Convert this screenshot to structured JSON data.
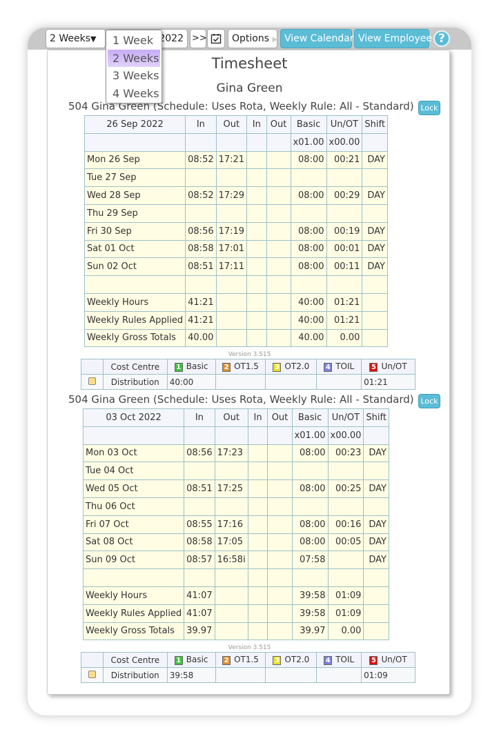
{
  "toolbar": {
    "period": "2 Weeks",
    "date_fragment": "2022",
    "next": ">>",
    "options": "Options",
    "view_calendar": "View Calendar",
    "view_employee": "View Employee",
    "help": "?"
  },
  "period_options": [
    "1 Week",
    "2 Weeks",
    "3 Weeks",
    "4 Weeks"
  ],
  "title": "Timesheet",
  "employee": "Gina Green",
  "columns": [
    "In",
    "Out",
    "In",
    "Out",
    "Basic",
    "Un/OT",
    "Shift"
  ],
  "rates": {
    "basic": "x01.00",
    "unot": "x00.00"
  },
  "lock_label": "Lock",
  "version": "Version 3.515",
  "colors": {
    "accent": "#5bbcd6",
    "row": "#fffde3",
    "b1": "#3cc43c",
    "b2": "#e0902a",
    "b3": "#e8e020",
    "b4": "#8080dd",
    "b5": "#dd1111"
  },
  "cost": {
    "headers": [
      "Cost Centre",
      "Basic",
      "OT1.5",
      "OT2.0",
      "TOIL",
      "Un/OT"
    ],
    "badges": [
      "1",
      "2",
      "3",
      "4",
      "5"
    ],
    "row_label": "Distribution"
  },
  "weeks": [
    {
      "header": "504 Gina Green (Schedule: Uses Rota, Weekly Rule: All - Standard)",
      "week": "26 Sep 2022",
      "days": [
        [
          "Mon 26 Sep",
          "08:52",
          "17:21",
          "",
          "",
          "08:00",
          "00:21",
          "DAY"
        ],
        [
          "Tue 27 Sep",
          "",
          "",
          "",
          "",
          "",
          "",
          ""
        ],
        [
          "Wed 28 Sep",
          "08:52",
          "17:29",
          "",
          "",
          "08:00",
          "00:29",
          "DAY"
        ],
        [
          "Thu 29 Sep",
          "",
          "",
          "",
          "",
          "",
          "",
          ""
        ],
        [
          "Fri 30 Sep",
          "08:56",
          "17:19",
          "",
          "",
          "08:00",
          "00:19",
          "DAY"
        ],
        [
          "Sat 01 Oct",
          "08:58",
          "17:01",
          "",
          "",
          "08:00",
          "00:01",
          "DAY"
        ],
        [
          "Sun 02 Oct",
          "08:51",
          "17:11",
          "",
          "",
          "08:00",
          "00:11",
          "DAY"
        ]
      ],
      "totals": [
        [
          "Weekly Hours",
          "41:21",
          "",
          "",
          "",
          "40:00",
          "01:21",
          ""
        ],
        [
          "Weekly Rules Applied",
          "41:21",
          "",
          "",
          "",
          "40:00",
          "01:21",
          ""
        ],
        [
          "Weekly Gross Totals",
          "40.00",
          "",
          "",
          "",
          "40.00",
          "0.00",
          ""
        ]
      ],
      "distribution": [
        "40:00",
        "",
        "",
        "",
        "01:21"
      ]
    },
    {
      "header": "504 Gina Green (Schedule: Uses Rota, Weekly Rule: All - Standard)",
      "week": "03 Oct 2022",
      "days": [
        [
          "Mon 03 Oct",
          "08:56",
          "17:23",
          "",
          "",
          "08:00",
          "00:23",
          "DAY"
        ],
        [
          "Tue 04 Oct",
          "",
          "",
          "",
          "",
          "",
          "",
          ""
        ],
        [
          "Wed 05 Oct",
          "08:51",
          "17:25",
          "",
          "",
          "08:00",
          "00:25",
          "DAY"
        ],
        [
          "Thu 06 Oct",
          "",
          "",
          "",
          "",
          "",
          "",
          ""
        ],
        [
          "Fri 07 Oct",
          "08:55",
          "17:16",
          "",
          "",
          "08:00",
          "00:16",
          "DAY"
        ],
        [
          "Sat 08 Oct",
          "08:58",
          "17:05",
          "",
          "",
          "08:00",
          "00:05",
          "DAY"
        ],
        [
          "Sun 09 Oct",
          "08:57",
          "16:58i",
          "",
          "",
          "07:58",
          "",
          "DAY"
        ]
      ],
      "totals": [
        [
          "Weekly Hours",
          "41:07",
          "",
          "",
          "",
          "39:58",
          "01:09",
          ""
        ],
        [
          "Weekly Rules Applied",
          "41:07",
          "",
          "",
          "",
          "39:58",
          "01:09",
          ""
        ],
        [
          "Weekly Gross Totals",
          "39.97",
          "",
          "",
          "",
          "39.97",
          "0.00",
          ""
        ]
      ],
      "distribution": [
        "39:58",
        "",
        "",
        "",
        "01:09"
      ]
    }
  ]
}
